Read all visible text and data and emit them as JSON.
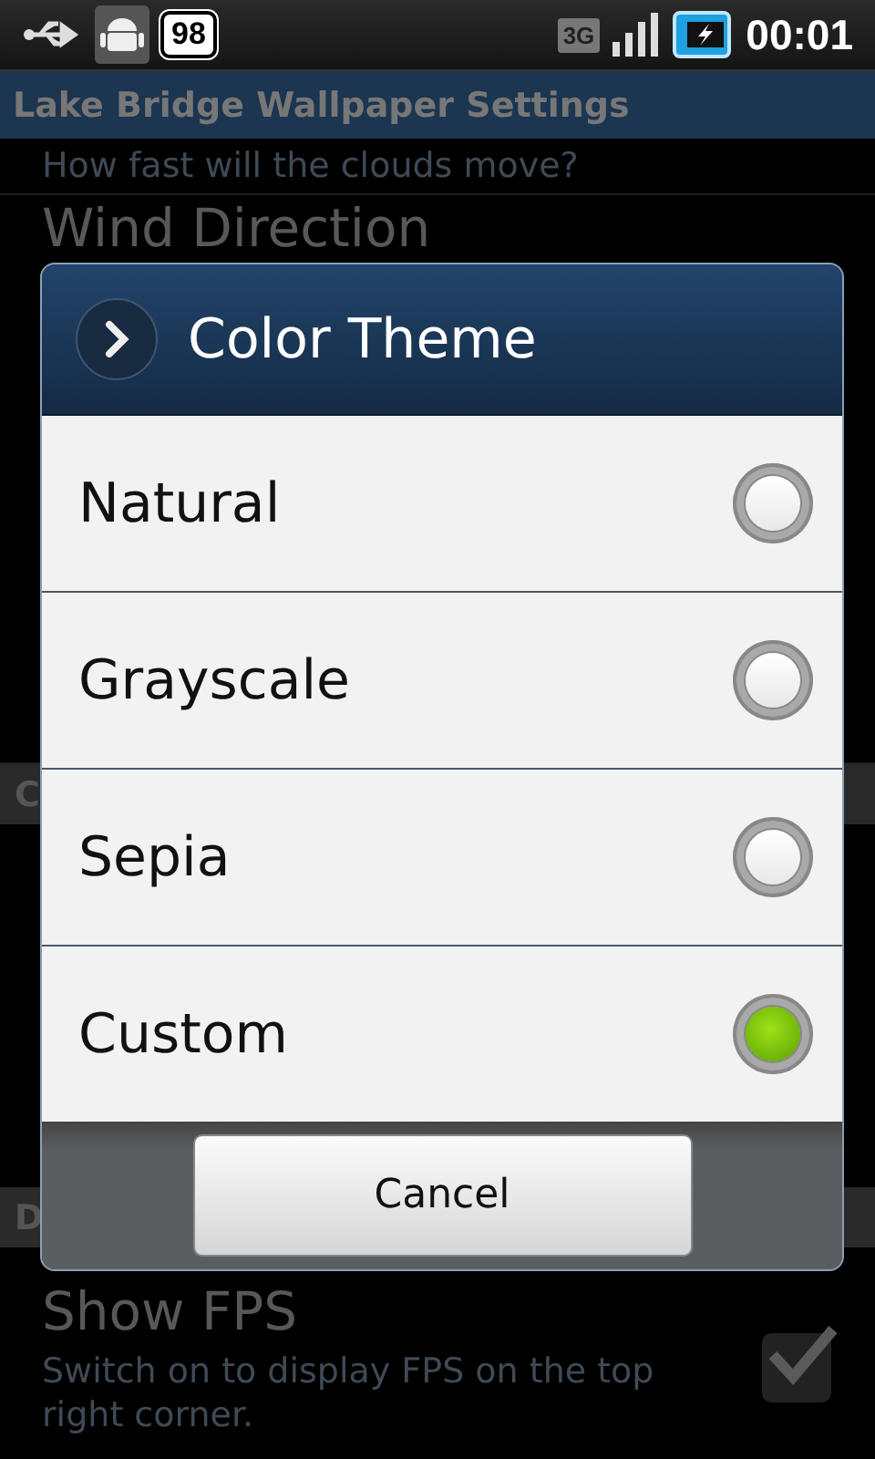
{
  "status_bar": {
    "notification_count": "98",
    "network": "3G",
    "time": "00:01"
  },
  "app_bar": {
    "title": "Lake Bridge Wallpaper Settings"
  },
  "settings": [
    {
      "kind": "summary",
      "summary": "How fast will the clouds move?"
    },
    {
      "kind": "title",
      "title": "Wind Direction"
    },
    {
      "kind": "header",
      "title": "C"
    },
    {
      "kind": "header",
      "title": "D"
    },
    {
      "kind": "checkbox",
      "title": "Show FPS",
      "summary": "Switch on to display FPS on the top right corner.",
      "checked": true
    }
  ],
  "dialog": {
    "title": "Color Theme",
    "options": [
      {
        "label": "Natural",
        "selected": false
      },
      {
        "label": "Grayscale",
        "selected": false
      },
      {
        "label": "Sepia",
        "selected": false
      },
      {
        "label": "Custom",
        "selected": true
      }
    ],
    "buttons": [
      "Cancel"
    ]
  }
}
